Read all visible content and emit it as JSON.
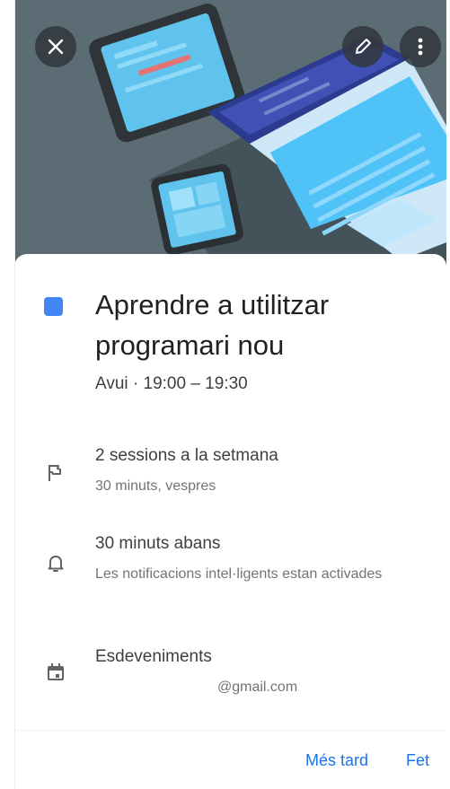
{
  "hero": {
    "illustration": "devices-illustration",
    "buttons": {
      "close_icon": "close-icon",
      "edit_icon": "pencil-icon",
      "more_icon": "more-vert-icon"
    }
  },
  "event": {
    "color": "#4285f4",
    "title": "Aprendre a utilitzar programari nou",
    "when": "Avui  ·  19:00 – 19:30"
  },
  "details": [
    {
      "icon": "flag-icon",
      "primary": "2 sessions a la setmana",
      "secondary": "30 minuts, vespres"
    },
    {
      "icon": "bell-icon",
      "primary": "30 minuts abans",
      "secondary": "Les notificacions intel·ligents estan activades"
    },
    {
      "icon": "calendar-icon",
      "primary": "Esdeveniments",
      "secondary": "@gmail.com"
    }
  ],
  "actions": {
    "later": "Més tard",
    "done": "Fet"
  },
  "colors": {
    "accent": "#1a73e8",
    "hero_background": "#5a6b73"
  }
}
